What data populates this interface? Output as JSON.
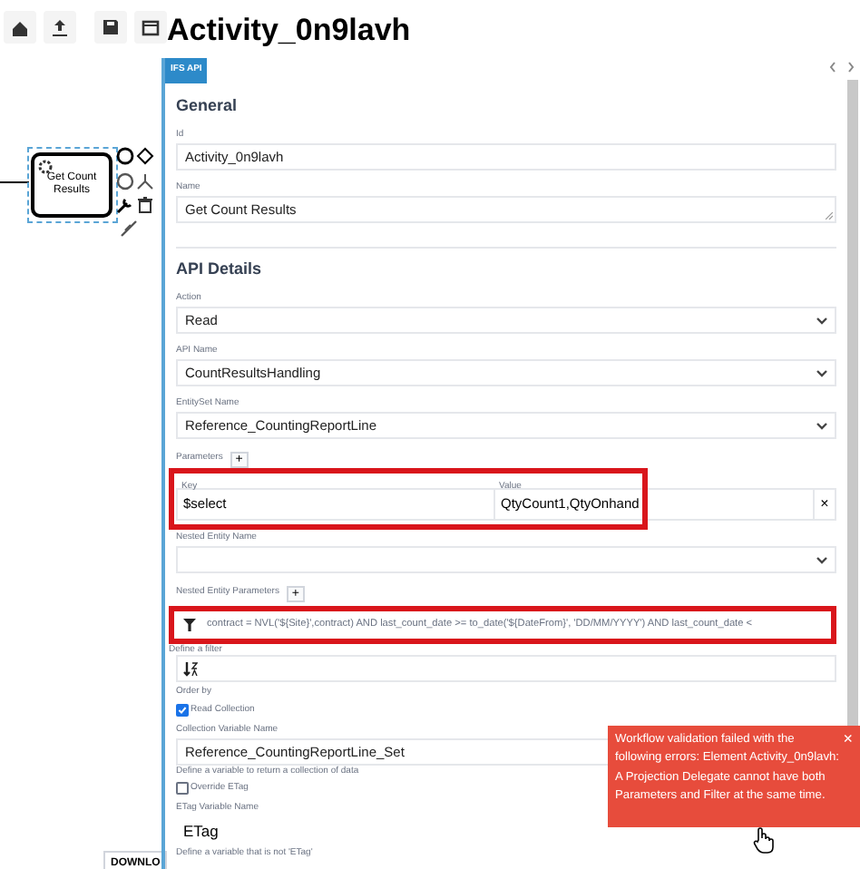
{
  "canvas": {
    "task": {
      "label": "Get Count Results",
      "selected": true
    },
    "download_button": "DOWNLO"
  },
  "panel": {
    "title": "Activity_0n9lavh",
    "tabs": [
      {
        "label": "IFS API",
        "selected": true
      }
    ],
    "sections": [
      {
        "title": "General",
        "fields": [
          {
            "kind": "input",
            "label": "Id",
            "value": "Activity_0n9lavh"
          },
          {
            "kind": "textarea",
            "label": "Name",
            "value": "Get Count Results"
          }
        ]
      },
      {
        "title": "API Details",
        "fields": [
          {
            "kind": "select",
            "label": "Action",
            "value": "Read"
          },
          {
            "kind": "select",
            "label": "API Name",
            "value": "CountResultsHandling"
          },
          {
            "kind": "select",
            "label": "EntitySet Name",
            "value": "Reference_CountingReportLine"
          },
          {
            "kind": "params",
            "label": "Parameters",
            "add": "+",
            "key_label": "Key",
            "value_label": "Value",
            "highlighted": true,
            "rows": [
              {
                "key": "$select",
                "value": "QtyCount1,QtyOnhand",
                "remove": "×"
              }
            ]
          },
          {
            "kind": "select",
            "label": "Nested Entity Name"
          },
          {
            "kind": "params",
            "label": "Nested Entity Parameters",
            "add": "+"
          },
          {
            "kind": "filter",
            "value": "contract = NVL('${Site}',contract)  AND  last_count_date >= to_date('${DateFrom}', 'DD/MM/YYYY') AND last_count_date <",
            "hint": "Define a filter",
            "highlighted": true
          },
          {
            "kind": "order",
            "hint": "Order by"
          },
          {
            "kind": "checkbox",
            "label": "Read Collection",
            "checked": true
          },
          {
            "kind": "input",
            "label": "Collection Variable Name",
            "value": "Reference_CountingReportLine_Set",
            "hint": "Define a variable to return a collection of data"
          },
          {
            "kind": "checkbox",
            "label": "Override ETag",
            "checked": false
          },
          {
            "kind": "plain",
            "label": "ETag Variable Name",
            "value": "ETag",
            "hint": "Define a variable that is not 'ETag'"
          }
        ]
      }
    ]
  },
  "toast": {
    "message": "Workflow validation failed with the following errors: Element Activity_0n9lavh: A Projection Delegate cannot have both Parameters and Filter at the same time.",
    "close": "×"
  }
}
